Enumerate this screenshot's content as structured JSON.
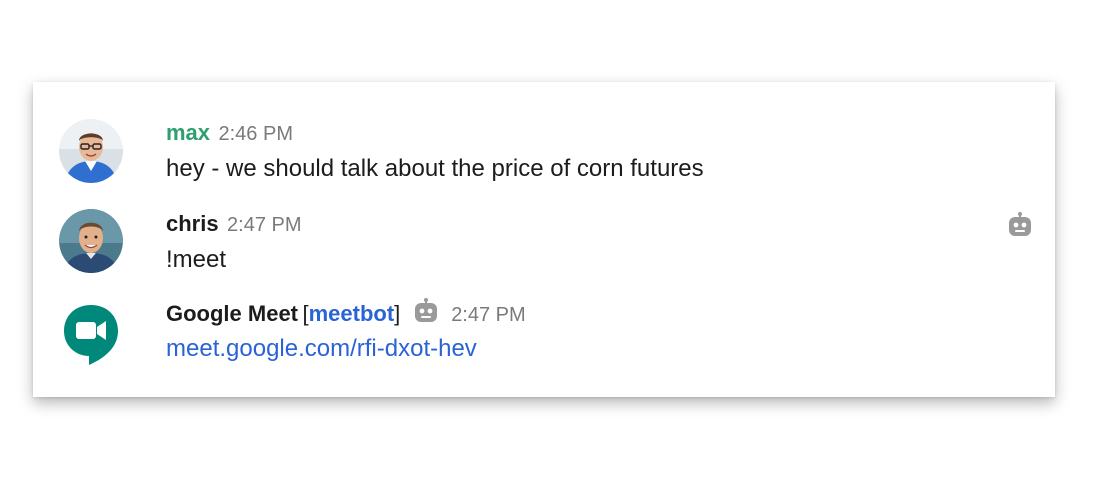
{
  "messages": [
    {
      "author": "max",
      "time": "2:46 PM",
      "text": "hey - we should talk about the price of corn futures",
      "name_color": "#2e9f71"
    },
    {
      "author": "chris",
      "time": "2:47 PM",
      "text": "!meet"
    },
    {
      "author": "Google Meet",
      "bracket_open": "[",
      "handle": "meetbot",
      "bracket_close": "]",
      "time": "2:47 PM",
      "link_text": "meet.google.com/rfi-dxot-hev"
    }
  ],
  "icons": {
    "bot": "robot-icon",
    "meet_logo": "google-meet-icon"
  },
  "colors": {
    "link": "#2a63d6",
    "meet_green": "#00897b"
  }
}
